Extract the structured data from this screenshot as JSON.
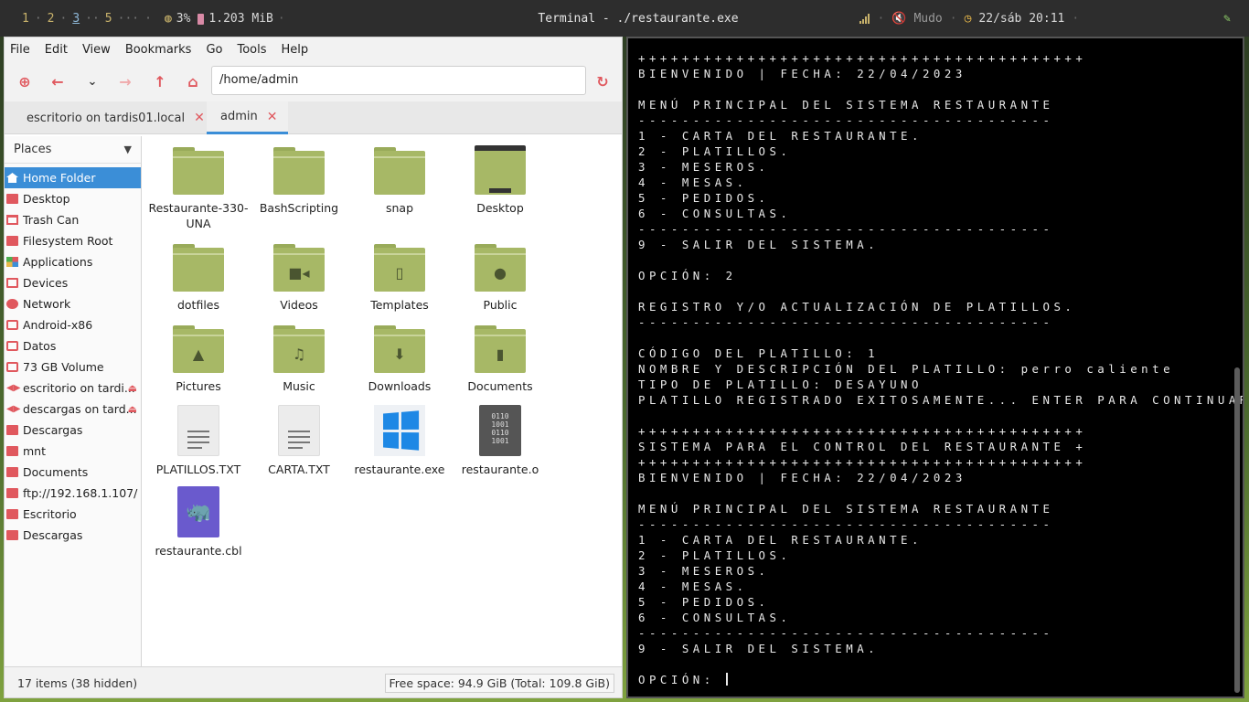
{
  "topbar": {
    "workspaces": [
      "1",
      "2",
      "3",
      "5"
    ],
    "active_workspace": "3",
    "more": "···",
    "cpu": "3%",
    "mem": "1.203 MiB",
    "window_title": "Terminal - ./restaurante.exe",
    "mute": "Mudo",
    "datetime": "22/sáb 20:11"
  },
  "fm": {
    "menu": [
      "File",
      "Edit",
      "View",
      "Bookmarks",
      "Go",
      "Tools",
      "Help"
    ],
    "address": "/home/admin",
    "tabs": [
      {
        "label": "escritorio on tardis01.local"
      },
      {
        "label": "admin"
      }
    ],
    "places_label": "Places",
    "places": [
      {
        "label": "Home Folder",
        "icon": "home-icon"
      },
      {
        "label": "Desktop",
        "icon": "folder-icon"
      },
      {
        "label": "Trash Can",
        "icon": "trash-icon"
      },
      {
        "label": "Filesystem Root",
        "icon": "folder-icon"
      },
      {
        "label": "Applications",
        "icon": "apps-icon"
      },
      {
        "label": "Devices",
        "icon": "devices-icon"
      },
      {
        "label": "Network",
        "icon": "network-icon"
      },
      {
        "label": "Android-x86",
        "icon": "drive-icon"
      },
      {
        "label": "Datos",
        "icon": "drive-icon"
      },
      {
        "label": "73 GB Volume",
        "icon": "drive-icon"
      },
      {
        "label": "escritorio on tardi...",
        "icon": "share-icon"
      },
      {
        "label": "descargas on tard...",
        "icon": "share-icon"
      },
      {
        "label": "Descargas",
        "icon": "folder-icon"
      },
      {
        "label": "mnt",
        "icon": "folder-icon"
      },
      {
        "label": "Documents",
        "icon": "folder-icon"
      },
      {
        "label": "ftp://192.168.1.107/",
        "icon": "folder-icon"
      },
      {
        "label": "Escritorio",
        "icon": "folder-icon"
      },
      {
        "label": "Descargas",
        "icon": "folder-icon"
      }
    ],
    "files": [
      {
        "label": "Restaurante-330-UNA",
        "kind": "folder"
      },
      {
        "label": "BashScripting",
        "kind": "folder"
      },
      {
        "label": "snap",
        "kind": "folder"
      },
      {
        "label": "Desktop",
        "kind": "desktop"
      },
      {
        "label": "dotfiles",
        "kind": "folder"
      },
      {
        "label": "Videos",
        "kind": "folder",
        "glyph": "video-icon"
      },
      {
        "label": "Templates",
        "kind": "folder",
        "glyph": "template-icon"
      },
      {
        "label": "Public",
        "kind": "folder",
        "glyph": "person-icon"
      },
      {
        "label": "Pictures",
        "kind": "folder",
        "glyph": "image-icon"
      },
      {
        "label": "Music",
        "kind": "folder",
        "glyph": "music-icon"
      },
      {
        "label": "Downloads",
        "kind": "folder",
        "glyph": "download-icon"
      },
      {
        "label": "Documents",
        "kind": "folder",
        "glyph": "document-icon"
      },
      {
        "label": "PLATILLOS.TXT",
        "kind": "text"
      },
      {
        "label": "CARTA.TXT",
        "kind": "text"
      },
      {
        "label": "restaurante.exe",
        "kind": "exe"
      },
      {
        "label": "restaurante.o",
        "kind": "binary"
      },
      {
        "label": "restaurante.cbl",
        "kind": "cobol"
      }
    ],
    "status_items": "17 items (38 hidden)",
    "status_space": "Free space: 94.9 GiB (Total: 109.8 GiB)"
  },
  "terminal": {
    "lines": [
      "+++++++++++++++++++++++++++++++++++++++++",
      "BIENVENIDO | FECHA: 22/04/2023",
      "",
      "MENÚ PRINCIPAL DEL SISTEMA RESTAURANTE",
      "--------------------------------------",
      "1 - CARTA DEL RESTAURANTE.",
      "2 - PLATILLOS.",
      "3 - MESEROS.",
      "4 - MESAS.",
      "5 - PEDIDOS.",
      "6 - CONSULTAS.",
      "--------------------------------------",
      "9 - SALIR DEL SISTEMA.",
      "",
      "OPCIÓN: 2",
      "",
      "REGISTRO Y/O ACTUALIZACIÓN DE PLATILLOS.",
      "--------------------------------------",
      "",
      "CÓDIGO DEL PLATILLO: 1",
      "NOMBRE Y DESCRIPCIÓN DEL PLATILLO: perro caliente",
      "TIPO DE PLATILLO: DESAYUNO",
      "PLATILLO REGISTRADO EXITOSAMENTE... ENTER PARA CONTINUAR",
      "",
      "+++++++++++++++++++++++++++++++++++++++++",
      "SISTEMA PARA EL CONTROL DEL RESTAURANTE +",
      "+++++++++++++++++++++++++++++++++++++++++",
      "BIENVENIDO | FECHA: 22/04/2023",
      "",
      "MENÚ PRINCIPAL DEL SISTEMA RESTAURANTE",
      "--------------------------------------",
      "1 - CARTA DEL RESTAURANTE.",
      "2 - PLATILLOS.",
      "3 - MESEROS.",
      "4 - MESAS.",
      "5 - PEDIDOS.",
      "6 - CONSULTAS.",
      "--------------------------------------",
      "9 - SALIR DEL SISTEMA.",
      ""
    ],
    "prompt": "OPCIÓN: "
  }
}
